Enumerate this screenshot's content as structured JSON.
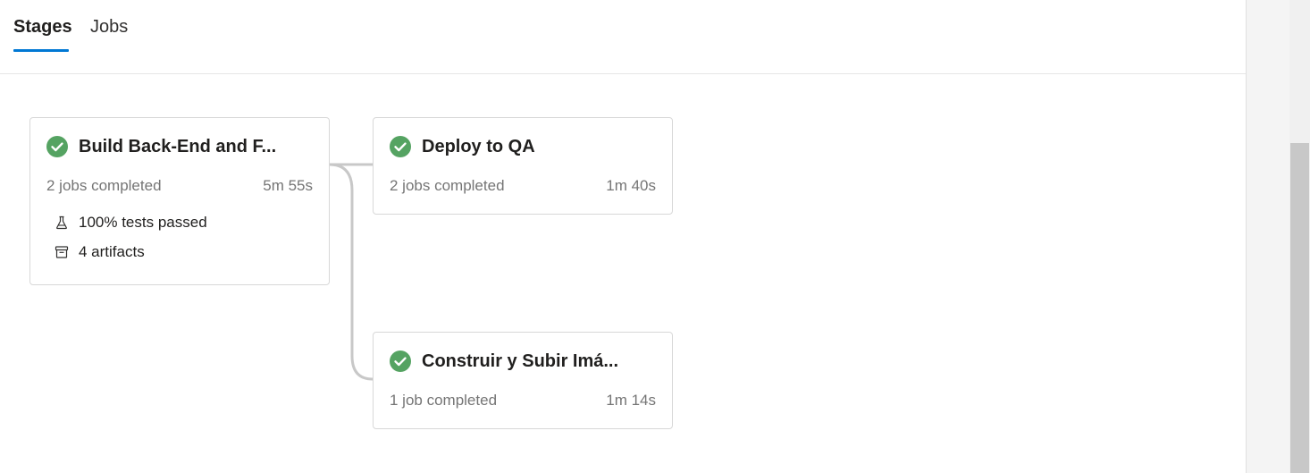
{
  "tabs": {
    "stages_label": "Stages",
    "jobs_label": "Jobs",
    "active": "Stages"
  },
  "colors": {
    "accent": "#0078d4",
    "success": "#55a362"
  },
  "stages": [
    {
      "title": "Build Back-End and F...",
      "jobs": "2 jobs completed",
      "duration": "5m 55s",
      "status_icon": "check-circle-icon",
      "tests": "100% tests passed",
      "tests_icon": "flask-icon",
      "artifacts": "4 artifacts",
      "artifacts_icon": "archive-icon"
    },
    {
      "title": "Deploy to QA",
      "jobs": "2 jobs completed",
      "duration": "1m 40s",
      "status_icon": "check-circle-icon"
    },
    {
      "title": "Construir y Subir Imá...",
      "jobs": "1 job completed",
      "duration": "1m 14s",
      "status_icon": "check-circle-icon"
    }
  ]
}
